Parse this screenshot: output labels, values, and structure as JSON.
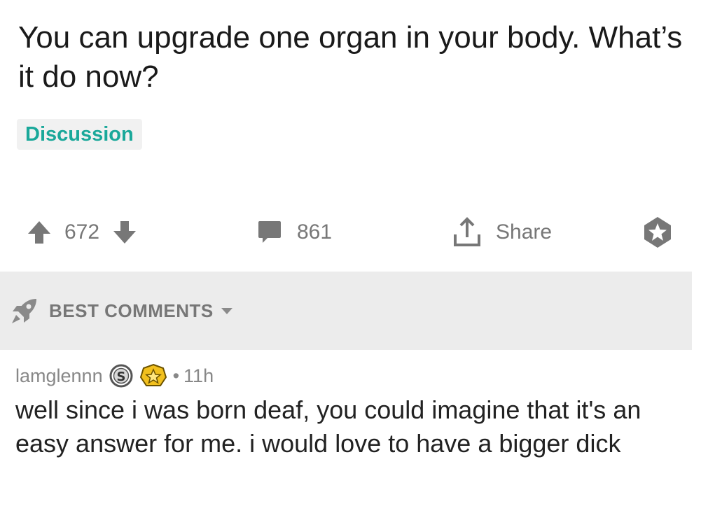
{
  "post": {
    "title": "You can upgrade one organ in your body. What’s it do now?",
    "flair": "Discussion"
  },
  "actions": {
    "upvote_icon": "arrow-up-icon",
    "score": "672",
    "downvote_icon": "arrow-down-icon",
    "comment_icon": "comment-icon",
    "comment_count": "861",
    "share_icon": "share-icon",
    "share_label": "Share",
    "save_icon": "star-icon"
  },
  "comments_header": {
    "icon": "rocket-icon",
    "label": "BEST COMMENTS",
    "caret_icon": "caret-down-icon"
  },
  "comment": {
    "author": "lamglennn",
    "badges": [
      "silver-award-icon",
      "gold-award-icon"
    ],
    "separator": "•",
    "age": "11h",
    "body": "well since i was born deaf, you could imagine that it's an easy answer for me. i would love to have a bigger dick"
  },
  "colors": {
    "flair": "#1aa89a",
    "muted": "#777777",
    "bar": "#ececec",
    "gold": "#f2c01e"
  }
}
